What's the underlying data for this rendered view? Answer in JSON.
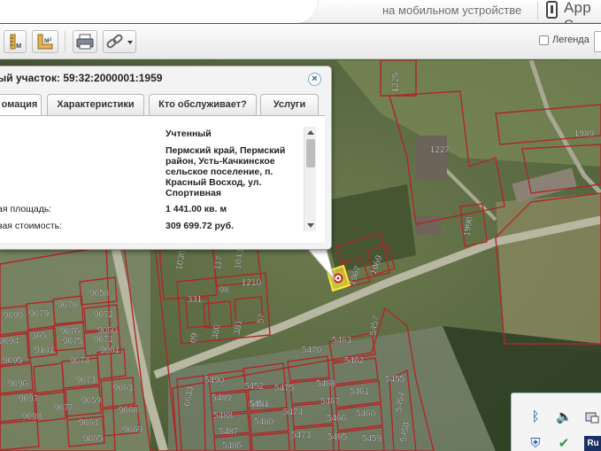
{
  "header": {
    "mobile_link": "на мобильном устройстве",
    "appstore_label": "App S"
  },
  "toolbar": {
    "tool1_label": "м",
    "tool2_label": "м²",
    "legend_label": "Легенда",
    "legend_checked": false
  },
  "popup": {
    "title": "ый участок: 59:32:2000001:1959",
    "close_label": "×",
    "tabs": [
      {
        "label": "омация",
        "active": true
      },
      {
        "label": "Характеристики",
        "active": false
      },
      {
        "label": "Кто обслуживает?",
        "active": false
      },
      {
        "label": "Услуги",
        "active": false
      }
    ],
    "rows": [
      {
        "label": "",
        "value": "Учтенный"
      },
      {
        "label": "",
        "value": "Пермский край, Пермский район, Усть-Качкинское сельское поселение, п. Красный Восход, ул. Спортивная"
      },
      {
        "label": "ая площадь:",
        "value": "1 441.00 кв. м"
      },
      {
        "label": "вая стоимость:",
        "value": "309 699.72 руб."
      }
    ]
  },
  "map": {
    "highlight_color": "#f2e23a",
    "parcel_color": "#b0272a",
    "parcel_labels": [
      "1225",
      "1227",
      "1990",
      "1989",
      "1969",
      "1967",
      "1210",
      "98",
      "331",
      "380",
      "381",
      "57",
      "09",
      "1043",
      "117",
      "1030",
      "9058",
      "9078",
      "9079",
      "9072",
      "9071",
      "9060",
      "9061",
      "9099",
      "365",
      "9076",
      "9075",
      "9074",
      "9073",
      "9101",
      "9094",
      "9095",
      "9096",
      "9097",
      "9098",
      "9077",
      "9059",
      "9063",
      "9068",
      "9065",
      "9069",
      "9064",
      "5490",
      "5489",
      "5488",
      "5487",
      "5486",
      "5452",
      "5451",
      "5481",
      "5480",
      "5475",
      "5474",
      "5473",
      "5468",
      "5467",
      "5466",
      "5465",
      "5463",
      "5462",
      "5461",
      "5460",
      "5459",
      "5470",
      "5455",
      "5454",
      "5457",
      "5458",
      "6633"
    ]
  },
  "tray": {
    "icons": [
      "bluetooth-icon",
      "speaker-icon",
      "network-icon",
      "shield-icon",
      "check-icon",
      "language-icon"
    ],
    "language_label": "Ru"
  }
}
